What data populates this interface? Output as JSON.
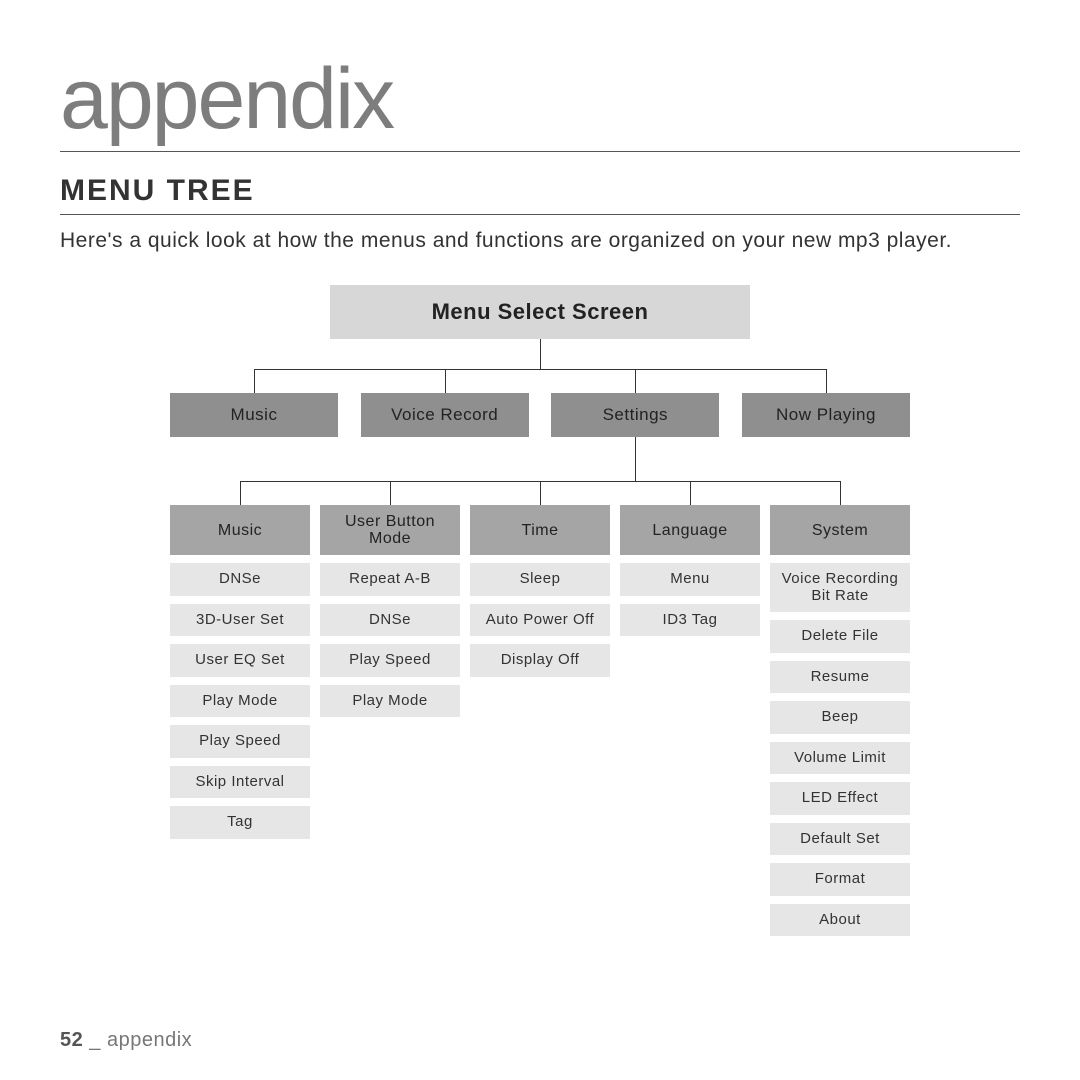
{
  "page_title": "appendix",
  "section_title": "MENU TREE",
  "intro": "Here's a quick look at how the menus and functions are organized on your new mp3 player.",
  "tree": {
    "root": "Menu Select Screen",
    "tier1": [
      "Music",
      "Voice Record",
      "Settings",
      "Now Playing"
    ],
    "tier2_headers": [
      "Music",
      "User Button Mode",
      "Time",
      "Language",
      "System"
    ],
    "columns": [
      [
        "DNSe",
        "3D-User Set",
        "User EQ Set",
        "Play Mode",
        "Play Speed",
        "Skip Interval",
        "Tag"
      ],
      [
        "Repeat A-B",
        "DNSe",
        "Play Speed",
        "Play Mode"
      ],
      [
        "Sleep",
        "Auto Power Off",
        "Display Off"
      ],
      [
        "Menu",
        "ID3 Tag"
      ],
      [
        "Voice Recording Bit Rate",
        "Delete File",
        "Resume",
        "Beep",
        "Volume Limit",
        "LED Effect",
        "Default Set",
        "Format",
        "About"
      ]
    ]
  },
  "footer": {
    "page_number": "52",
    "separator": " _ ",
    "label": "appendix"
  }
}
